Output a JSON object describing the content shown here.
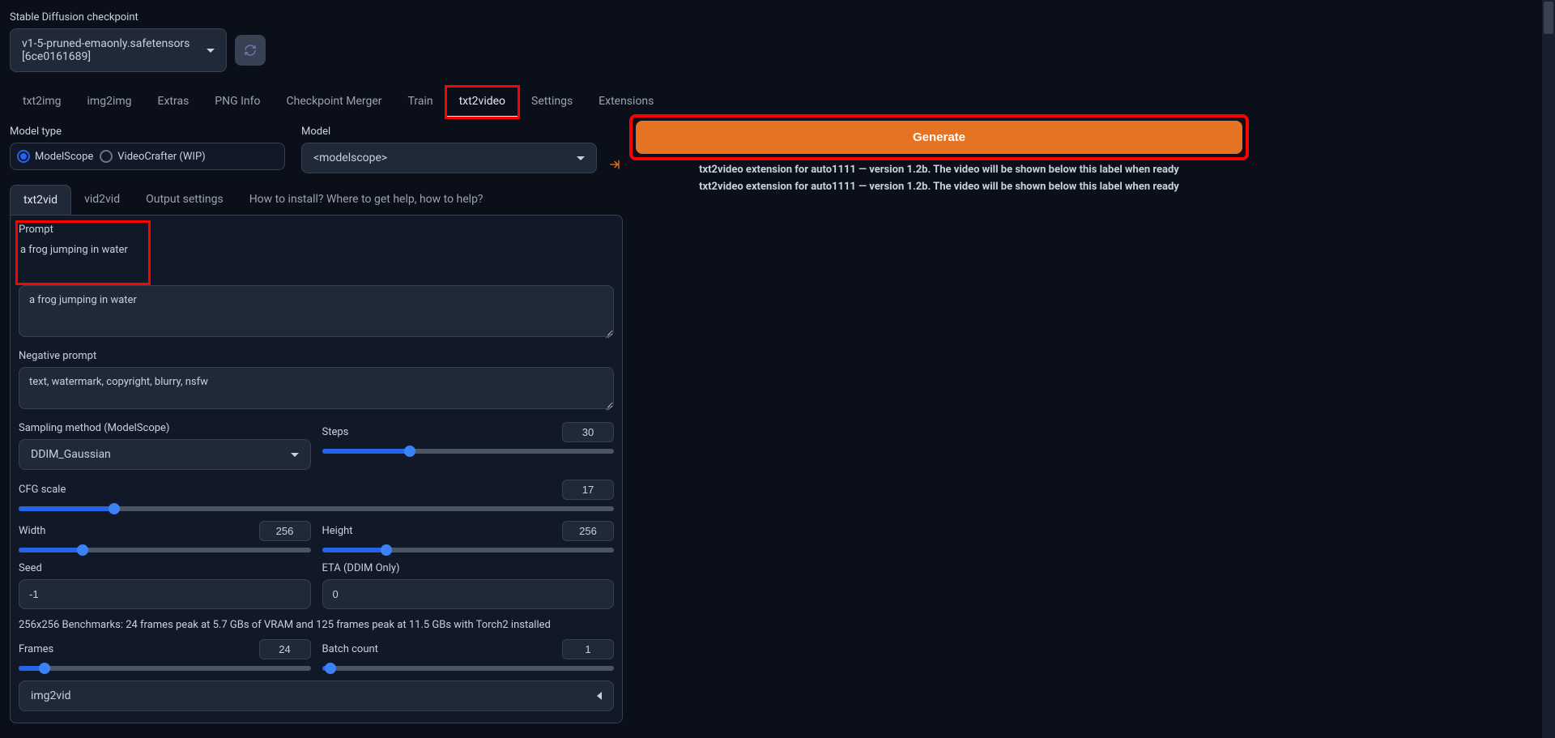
{
  "checkpoint": {
    "label": "Stable Diffusion checkpoint",
    "value": "v1-5-pruned-emaonly.safetensors [6ce0161689]"
  },
  "tabs": [
    "txt2img",
    "img2img",
    "Extras",
    "PNG Info",
    "Checkpoint Merger",
    "Train",
    "txt2video",
    "Settings",
    "Extensions"
  ],
  "subtabs": [
    "txt2vid",
    "vid2vid",
    "Output settings",
    "How to install? Where to get help, how to help?"
  ],
  "model_type": {
    "label": "Model type",
    "options": [
      "ModelScope",
      "VideoCrafter (WIP)"
    ],
    "selected": "ModelScope"
  },
  "model": {
    "label": "Model",
    "value": "<modelscope>"
  },
  "prompt": {
    "label": "Prompt",
    "value": "a frog jumping in water"
  },
  "neg_prompt": {
    "label": "Negative prompt",
    "value": "text, watermark, copyright, blurry, nsfw"
  },
  "sampling": {
    "label": "Sampling method (ModelScope)",
    "value": "DDIM_Gaussian"
  },
  "steps": {
    "label": "Steps",
    "value": "30",
    "pct": 30
  },
  "cfg": {
    "label": "CFG scale",
    "value": "17",
    "pct": 16
  },
  "width": {
    "label": "Width",
    "value": "256",
    "pct": 22
  },
  "height": {
    "label": "Height",
    "value": "256",
    "pct": 22
  },
  "seed": {
    "label": "Seed",
    "value": "-1"
  },
  "eta": {
    "label": "ETA (DDIM Only)",
    "value": "0"
  },
  "benchmark": "256x256 Benchmarks: 24 frames peak at 5.7 GBs of VRAM and 125 frames peak at 11.5 GBs with Torch2 installed",
  "frames": {
    "label": "Frames",
    "value": "24",
    "pct": 9
  },
  "batch": {
    "label": "Batch count",
    "value": "1",
    "pct": 3
  },
  "accordion": "img2vid",
  "generate": "Generate",
  "status1": "txt2video extension for auto1111 — version 1.2b. The video will be shown below this label when ready",
  "status2": "txt2video extension for auto1111 — version 1.2b. The video will be shown below this label when ready"
}
